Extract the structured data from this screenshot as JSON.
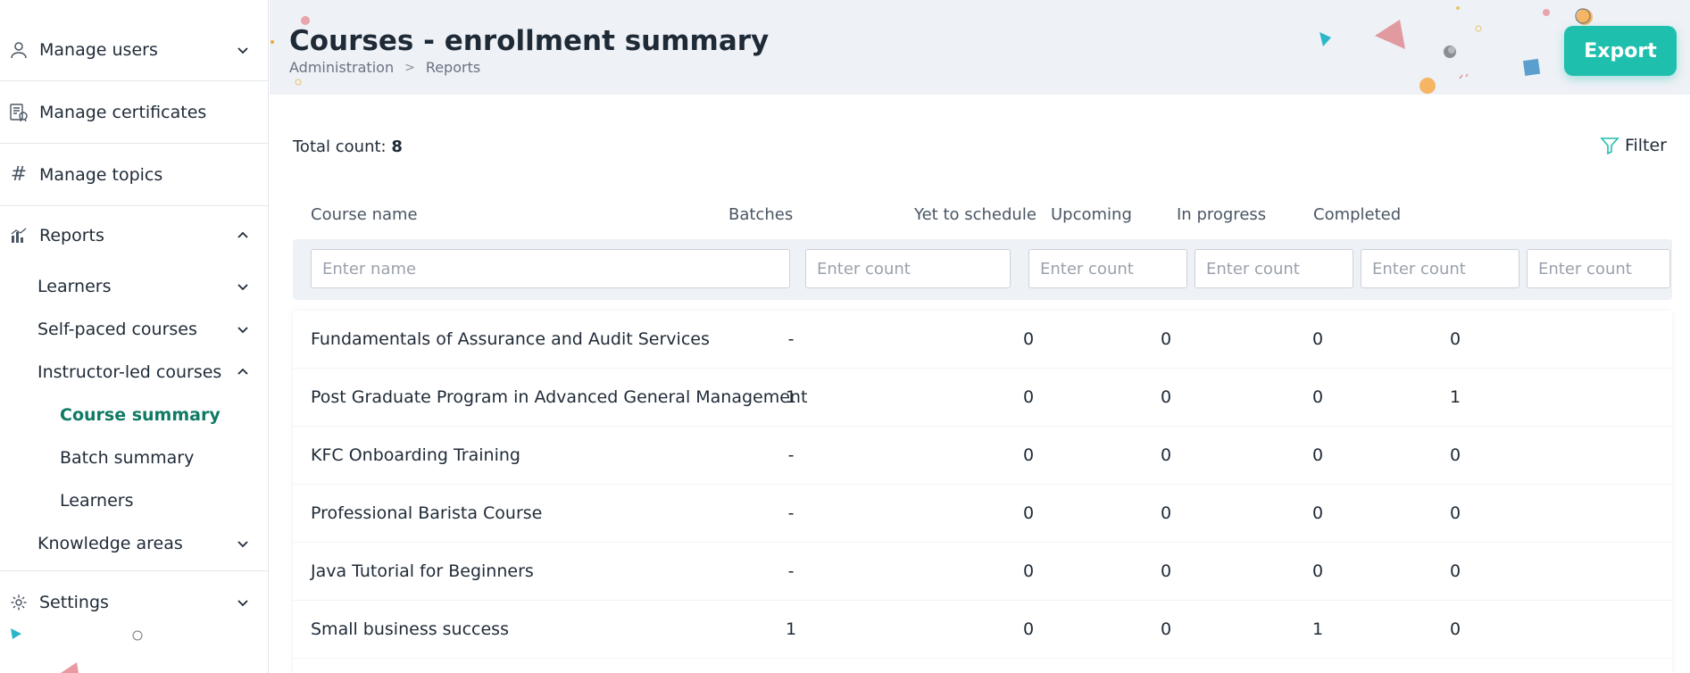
{
  "sidebar": {
    "manage_users": "Manage users",
    "manage_certificates": "Manage certificates",
    "manage_topics": "Manage topics",
    "reports": "Reports",
    "learners": "Learners",
    "self_paced": "Self-paced courses",
    "instructor_led": "Instructor-led courses",
    "course_summary": "Course summary",
    "batch_summary": "Batch summary",
    "il_learners": "Learners",
    "knowledge_areas": "Knowledge areas",
    "settings": "Settings"
  },
  "header": {
    "title": "Courses - enrollment summary",
    "breadcrumb": [
      "Administration",
      "Reports"
    ],
    "export_label": "Export"
  },
  "summary": {
    "total_label": "Total count:",
    "total_value": "8",
    "filter_label": "Filter"
  },
  "table": {
    "columns": [
      "Course name",
      "Batches",
      "Yet to schedule",
      "Upcoming",
      "In progress",
      "Completed"
    ],
    "placeholders": {
      "name": "Enter name",
      "count": "Enter count"
    },
    "rows": [
      {
        "name": "Fundamentals of Assurance and Audit Services",
        "batches": "-",
        "yet": "0",
        "upcoming": "0",
        "progress": "0",
        "completed": "0"
      },
      {
        "name": "Post Graduate Program in Advanced General Management",
        "batches": "1",
        "yet": "0",
        "upcoming": "0",
        "progress": "0",
        "completed": "1"
      },
      {
        "name": "KFC Onboarding Training",
        "batches": "-",
        "yet": "0",
        "upcoming": "0",
        "progress": "0",
        "completed": "0"
      },
      {
        "name": "Professional Barista Course",
        "batches": "-",
        "yet": "0",
        "upcoming": "0",
        "progress": "0",
        "completed": "0"
      },
      {
        "name": "Java Tutorial for Beginners",
        "batches": "-",
        "yet": "0",
        "upcoming": "0",
        "progress": "0",
        "completed": "0"
      },
      {
        "name": "Small business success",
        "batches": "1",
        "yet": "0",
        "upcoming": "0",
        "progress": "1",
        "completed": "0"
      }
    ]
  },
  "colors": {
    "accent": "#1fbfae",
    "active_link": "#0f7a64",
    "header_bg": "#eef1f6"
  }
}
